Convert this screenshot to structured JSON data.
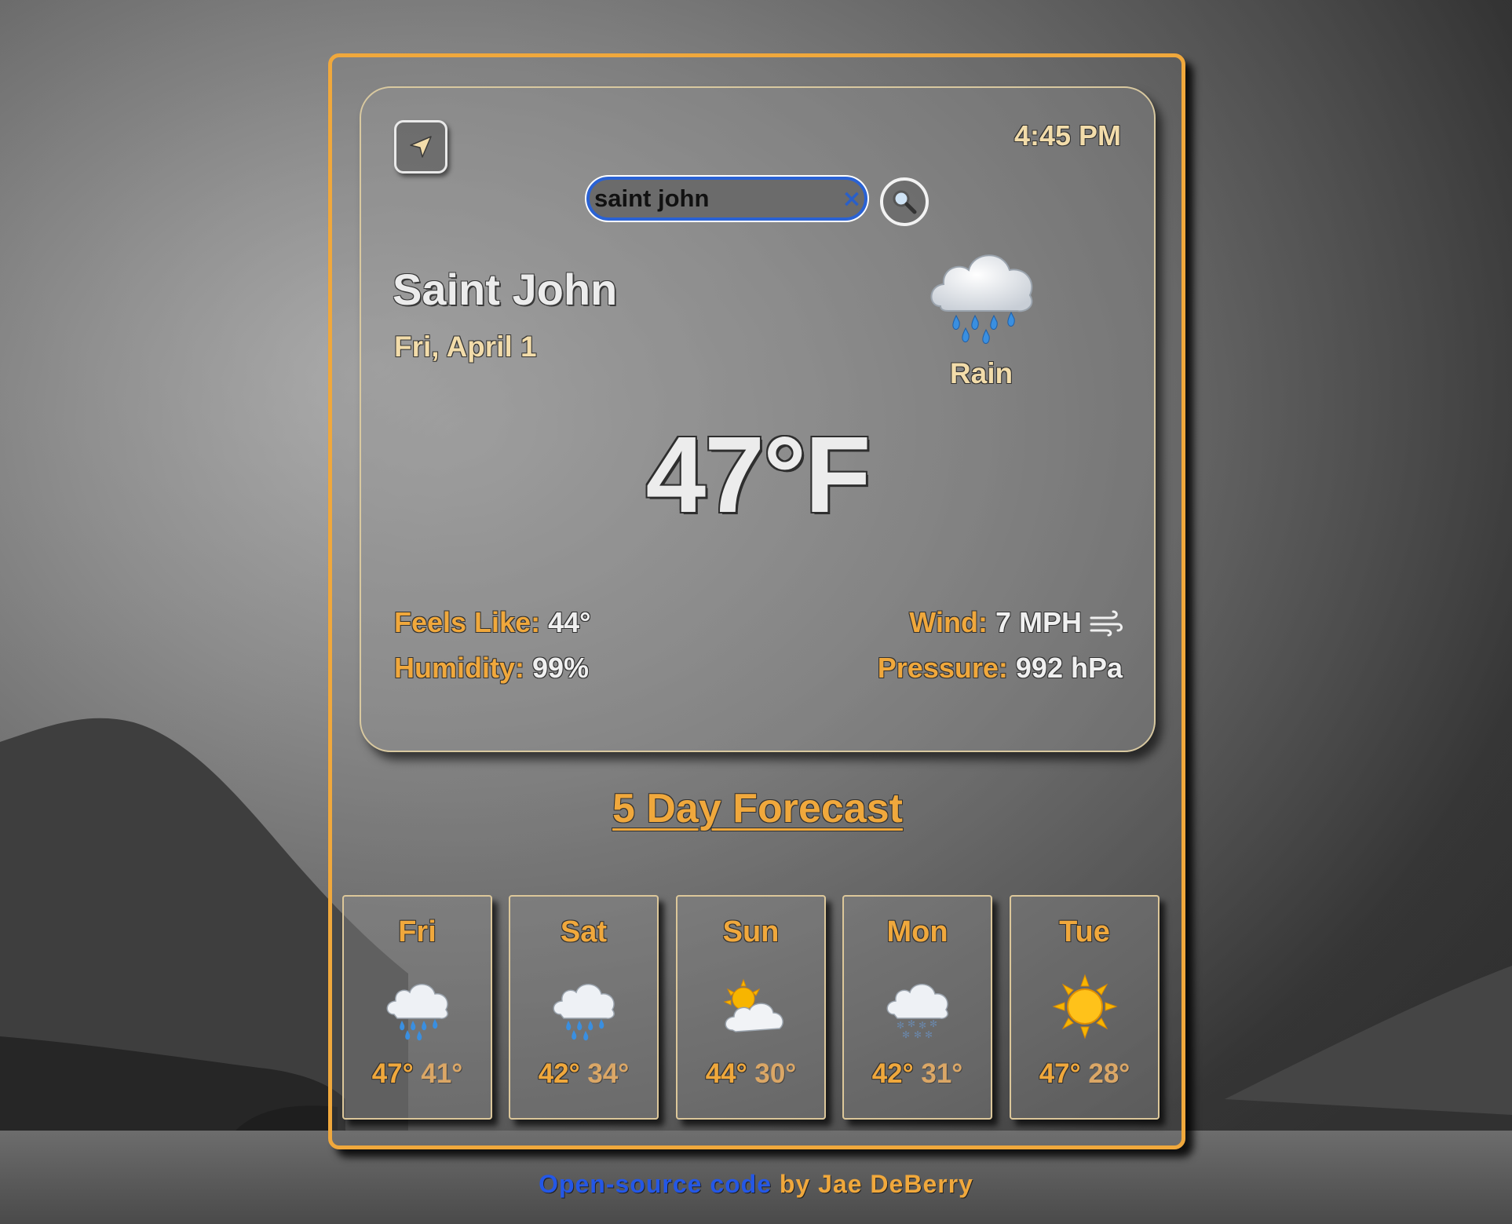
{
  "header": {
    "time": "4:45 PM",
    "location_icon": "location-arrow-icon"
  },
  "search": {
    "value": "saint john",
    "placeholder": "",
    "clear_icon": "clear-x-icon",
    "button_icon": "magnifying-glass-icon"
  },
  "current": {
    "city": "Saint John",
    "date": "Fri, April 1",
    "condition": "Rain",
    "icon": "cloud-with-rain-icon",
    "temperature": "47°F",
    "feels_like_label": "Feels Like:",
    "feels_like_value": "44°",
    "humidity_label": "Humidity:",
    "humidity_value": "99%",
    "wind_label": "Wind:",
    "wind_value": "7 MPH",
    "wind_icon": "wind-icon",
    "pressure_label": "Pressure:",
    "pressure_value": "992 hPa"
  },
  "forecast": {
    "title": "5 Day Forecast",
    "days": [
      {
        "day": "Fri",
        "icon": "cloud-with-rain-icon",
        "high": "47°",
        "low": "41°"
      },
      {
        "day": "Sat",
        "icon": "cloud-with-rain-icon",
        "high": "42°",
        "low": "34°"
      },
      {
        "day": "Sun",
        "icon": "sun-behind-cloud-icon",
        "high": "44°",
        "low": "30°"
      },
      {
        "day": "Mon",
        "icon": "cloud-with-snow-icon",
        "high": "42°",
        "low": "31°"
      },
      {
        "day": "Tue",
        "icon": "sun-icon",
        "high": "47°",
        "low": "28°"
      }
    ]
  },
  "footer": {
    "link_text": "Open-source code",
    "by_text": "by Jae DeBerry"
  },
  "colors": {
    "accent": "#f0a83c",
    "cream": "#f2dcaa",
    "link": "#2457e6",
    "search_border": "#2a62d4"
  }
}
